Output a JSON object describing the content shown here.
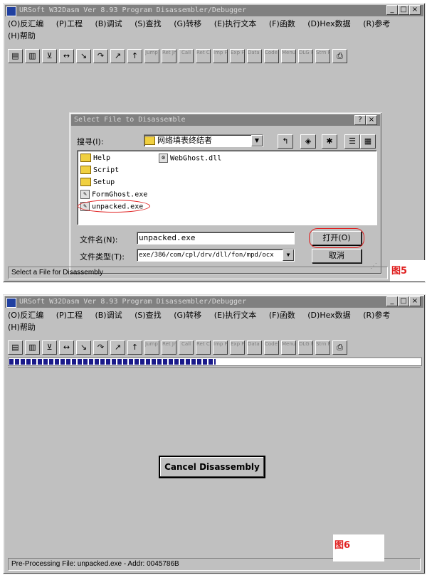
{
  "window": {
    "title": "URSoft W32Dasm Ver 8.93 Program Disassembler/Debugger",
    "menus": [
      "(O)反汇编",
      "(P)工程",
      "(B)调试",
      "(S)查找",
      "(G)转移",
      "(E)执行文本",
      "(F)函数",
      "(D)Hex数据",
      "(R)参考",
      "(H)帮助"
    ],
    "toolbar_labels": [
      "Jump To",
      "Ret Jmp",
      "Call",
      "Ret Call",
      "Imp Fn",
      "Exp Fn",
      "Data Hex",
      "Code Hex",
      "Menu Ref",
      "DLG Ref",
      "Strn Ref"
    ]
  },
  "screen1": {
    "status": "Select a File for Disassembly",
    "figure_label": "图5",
    "dialog": {
      "title": "Select File to Disassemble",
      "look_in_label": "搜寻(I):",
      "look_in_value": "网络填表终结者",
      "files": [
        "Help",
        "Script",
        "Setup",
        "FormGhost.exe",
        "unpacked.exe",
        "WebGhost.dll"
      ],
      "filename_label": "文件名(N):",
      "filename_value": "unpacked.exe",
      "filetype_label": "文件类型(T):",
      "filetype_value": "exe/386/com/cpl/drv/dll/fon/mpd/ocx",
      "open_button": "打开(O)",
      "cancel_button": "取消"
    }
  },
  "screen2": {
    "status": "Pre-Processing File: unpacked.exe - Addr: 0045786B",
    "figure_label": "图6",
    "cancel_button": "Cancel Disassembly",
    "progress": 0.5
  }
}
